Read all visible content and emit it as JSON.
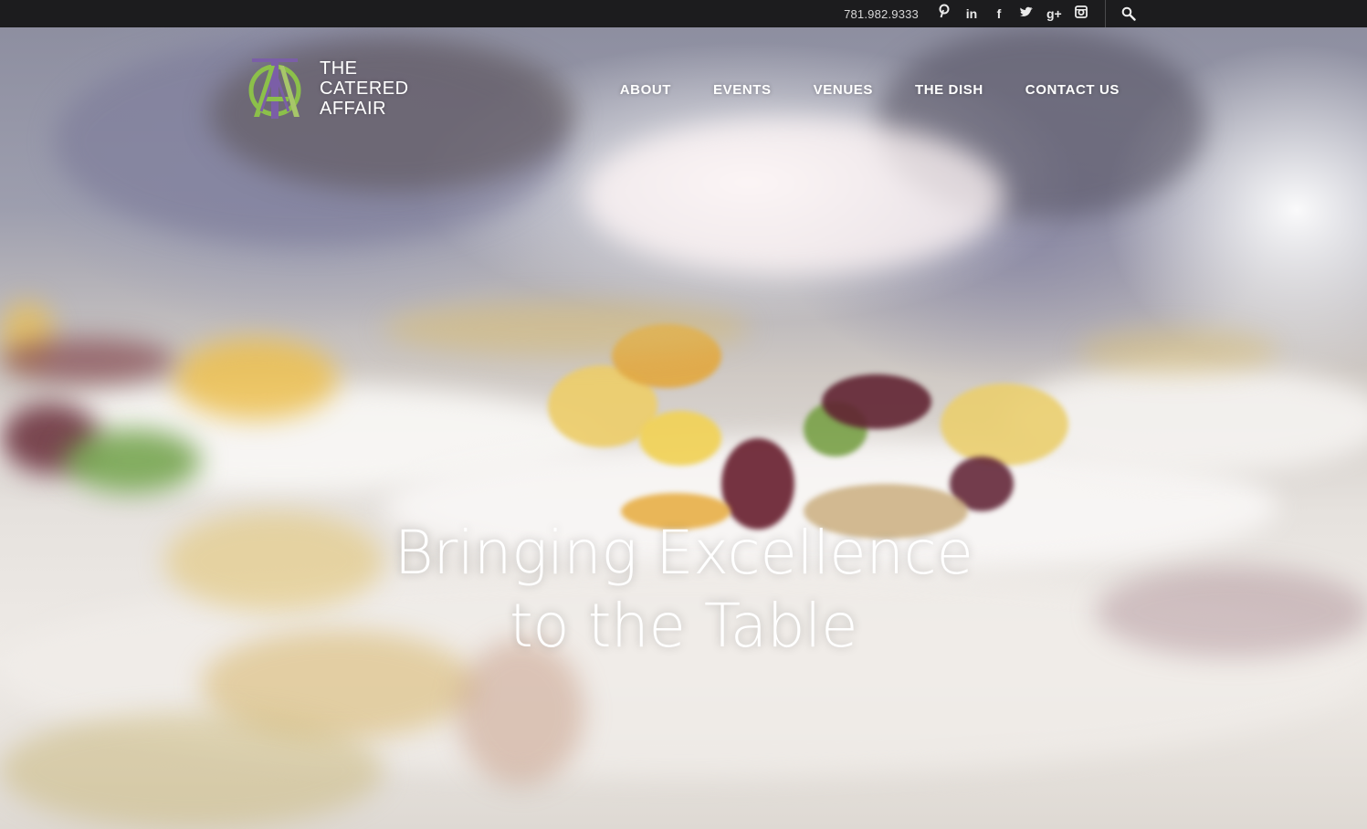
{
  "topbar": {
    "phone": "781.982.9333",
    "social_icons": [
      "pinterest-icon",
      "linkedin-icon",
      "facebook-icon",
      "twitter-icon",
      "google-plus-icon",
      "instagram-icon"
    ],
    "social_glyphs": [
      "℗",
      "in",
      "f",
      "t",
      "g+",
      "◙"
    ],
    "search_icon": "search-icon"
  },
  "logo": {
    "line1": "THE",
    "line2": "CATERED",
    "line3": "AFFAIR",
    "colors": {
      "purple": "#7b5ea7",
      "green": "#8cc04a"
    }
  },
  "nav": {
    "items": [
      {
        "label": "ABOUT"
      },
      {
        "label": "EVENTS"
      },
      {
        "label": "VENUES"
      },
      {
        "label": "THE DISH"
      },
      {
        "label": "CONTACT US"
      }
    ]
  },
  "hero": {
    "headline_line1": "Bringing Excellence",
    "headline_line2": "to the Table"
  }
}
